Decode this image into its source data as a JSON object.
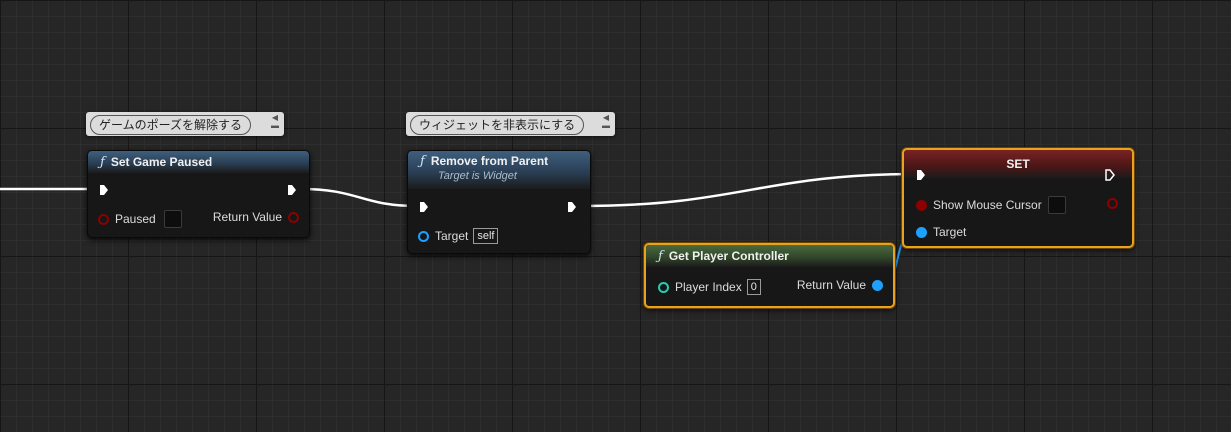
{
  "comments": {
    "set_game_paused": "ゲームのポーズを解除する",
    "remove_from_parent": "ウィジェットを非表示にする"
  },
  "nodes": {
    "set_game_paused": {
      "icon": "ƒ",
      "title": "Set Game Paused",
      "pins": {
        "paused": "Paused",
        "return_value": "Return Value"
      }
    },
    "remove_from_parent": {
      "icon": "ƒ",
      "title": "Remove from Parent",
      "subtitle": "Target is Widget",
      "pins": {
        "target": "Target",
        "target_value": "self"
      }
    },
    "set": {
      "title": "SET",
      "pins": {
        "show_mouse_cursor": "Show Mouse Cursor",
        "target": "Target"
      }
    },
    "get_player_controller": {
      "icon": "ƒ",
      "title": "Get Player Controller",
      "pins": {
        "player_index": "Player Index",
        "player_index_value": "0",
        "return_value": "Return Value"
      }
    }
  },
  "colors": {
    "exec_pin": "#ffffff",
    "bool_pin": "#8b0000",
    "object_pin": "#1ea0ff",
    "int_pin": "#20d0b0",
    "selection": "#e8a21c"
  }
}
